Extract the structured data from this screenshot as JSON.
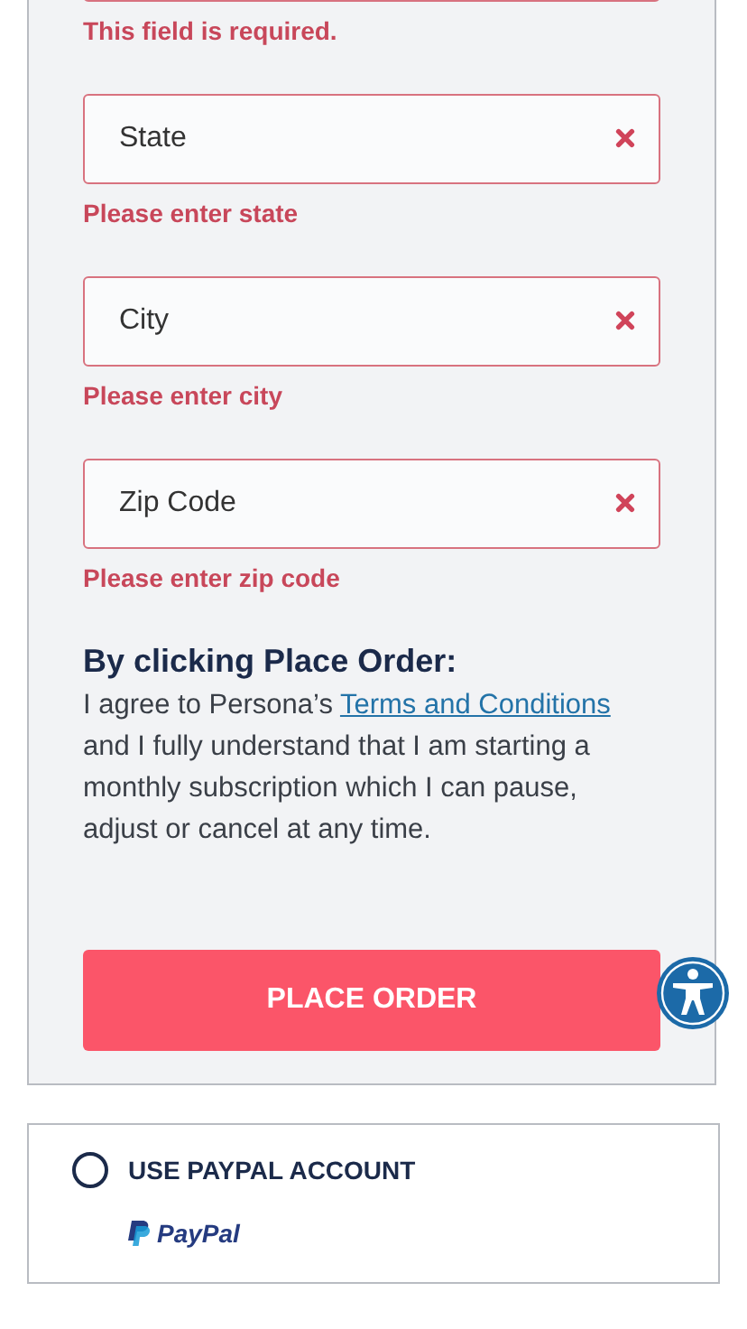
{
  "fields": [
    {
      "error": "This field is required.",
      "invalid": true
    },
    {
      "placeholder": "State",
      "error": "Please enter state",
      "invalid": true
    },
    {
      "placeholder": "City",
      "error": "Please enter city",
      "invalid": true
    },
    {
      "placeholder": "Zip Code",
      "error": "Please enter zip code",
      "invalid": true
    }
  ],
  "agreement": {
    "heading": "By clicking Place Order:",
    "before": "I agree to Persona’s ",
    "link": "Terms and Conditions",
    "after": " and I fully understand that I am starting a monthly subscription which I can pause, adjust or cancel at any time."
  },
  "place_order_button": "PLACE ORDER",
  "paypal_option": {
    "label": "USE PAYPAL ACCOUNT",
    "selected": false,
    "logo": "PayPal"
  }
}
